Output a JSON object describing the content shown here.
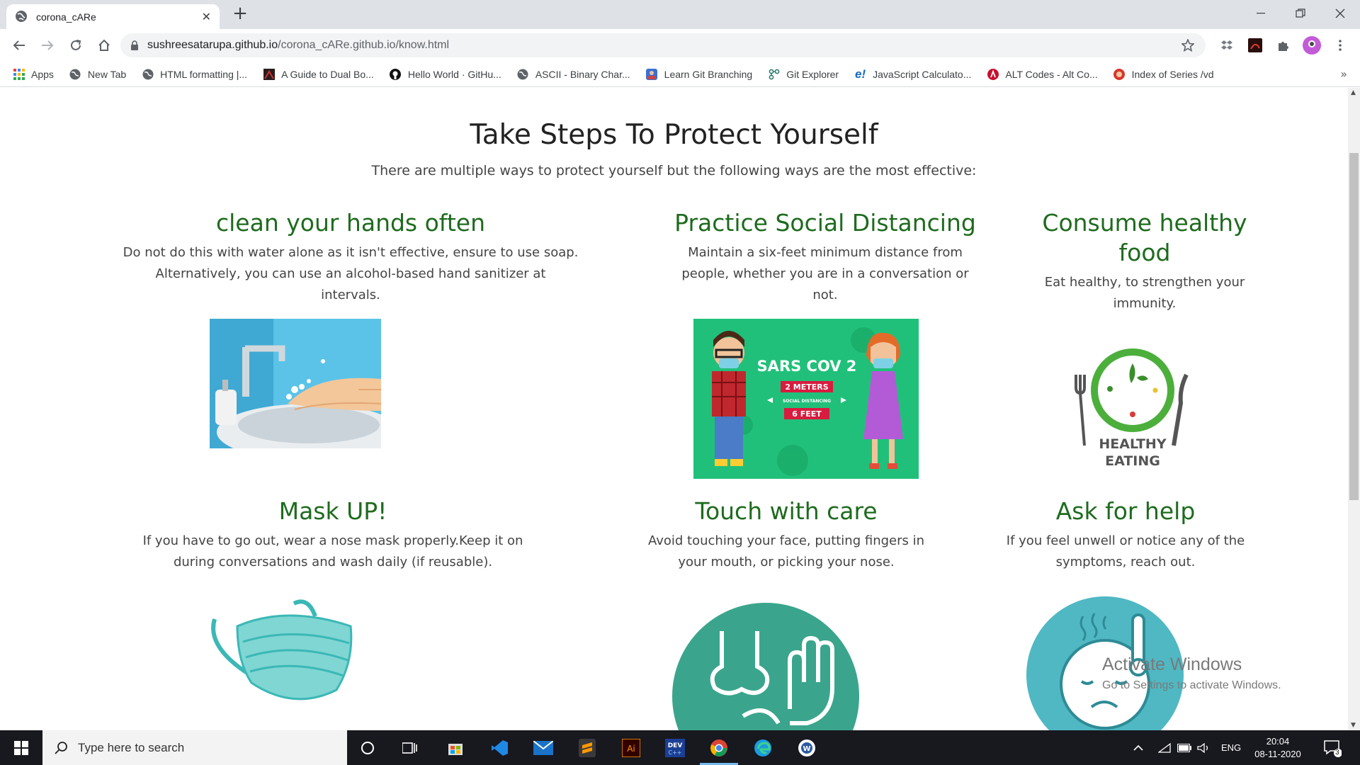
{
  "browser": {
    "tab_title": "corona_cARe",
    "url_host": "sushreesatarupa.github.io",
    "url_path": "/corona_cARe.github.io/know.html",
    "bookmarks": [
      {
        "label": "Apps",
        "icon": "apps-grid-icon"
      },
      {
        "label": "New Tab",
        "icon": "globe-icon"
      },
      {
        "label": "HTML formatting |...",
        "icon": "globe-icon"
      },
      {
        "label": "A Guide to Dual Bo...",
        "icon": "site-icon"
      },
      {
        "label": "Hello World · GitHu...",
        "icon": "github-icon"
      },
      {
        "label": "ASCII - Binary Char...",
        "icon": "globe-icon"
      },
      {
        "label": "Learn Git Branching",
        "icon": "git-icon"
      },
      {
        "label": "Git Explorer",
        "icon": "git-explorer-icon"
      },
      {
        "label": "JavaScript Calculato...",
        "icon": "e-icon"
      },
      {
        "label": "ALT Codes - Alt Co...",
        "icon": "alt-codes-icon"
      },
      {
        "label": "Index of Series /vd",
        "icon": "index-icon"
      }
    ]
  },
  "page": {
    "title": "Take Steps To Protect Yourself",
    "subtitle": "There are multiple ways to protect yourself but the following ways are the most effective:",
    "cards": [
      {
        "heading": "clean your hands often",
        "text": [
          "Do not do this with water alone as it isn't effective, ensure to use soap.",
          "Alternatively, you can use an alcohol-based hand sanitizer at",
          "intervals."
        ]
      },
      {
        "heading": "Practice Social Distancing",
        "text": [
          "Maintain a six-feet minimum distance from",
          "people, whether you are in a conversation or",
          "not."
        ]
      },
      {
        "heading_lines": [
          "Consume healthy",
          "food"
        ],
        "text": [
          "Eat healthy, to strengthen your",
          "immunity."
        ]
      },
      {
        "heading": "Mask UP!",
        "text": [
          "If you have to go out, wear a nose mask properly.Keep it on",
          "during conversations and wash daily (if reusable)."
        ]
      },
      {
        "heading": "Touch with care",
        "text": [
          "Avoid touching your face, putting fingers in",
          "your mouth, or picking your nose."
        ]
      },
      {
        "heading": "Ask for help",
        "text": [
          "If you feel unwell or notice any of the",
          "symptoms, reach out."
        ]
      }
    ],
    "distancing_art": {
      "title": "SARS COV 2",
      "line1": "2 METERS",
      "line2": "SOCIAL DISTANCING",
      "line3": "6 FEET"
    },
    "healthy_art": {
      "line1": "HEALTHY",
      "line2": "EATING"
    }
  },
  "watermark": {
    "line1": "Activate Windows",
    "line2": "Go to Settings to activate Windows."
  },
  "taskbar": {
    "search_placeholder": "Type here to search",
    "lang": "ENG",
    "time": "20:04",
    "date": "08-11-2020",
    "notifications": "3"
  },
  "colors": {
    "heading_green": "#1e6b1e",
    "accent_teal": "#3aa58c"
  }
}
